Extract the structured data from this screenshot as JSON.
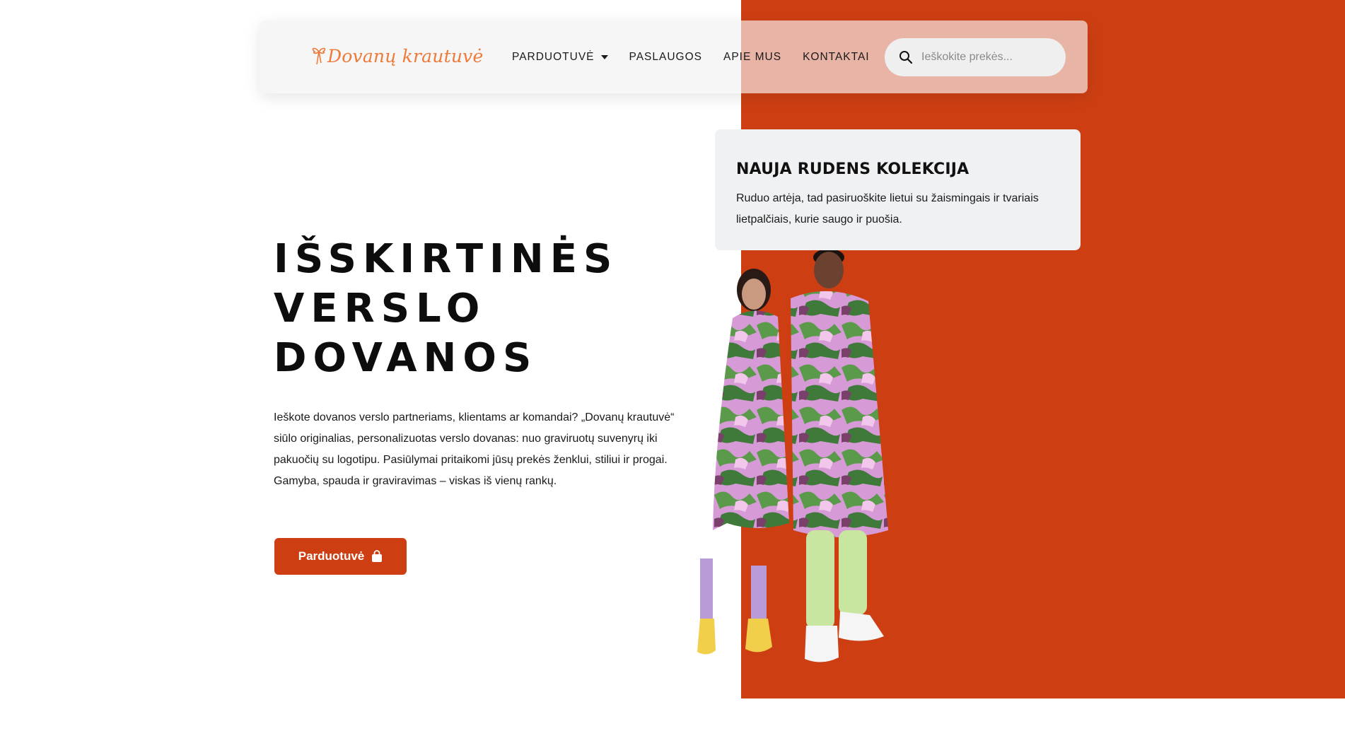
{
  "brand": {
    "logo_text": "Dovanų krautuvė",
    "color": "#ee7a3a"
  },
  "nav": {
    "items": [
      {
        "label": "PARDUOTUVĖ",
        "has_dropdown": true
      },
      {
        "label": "PASLAUGOS"
      },
      {
        "label": "APIE MUS"
      },
      {
        "label": "KONTAKTAI"
      }
    ]
  },
  "search": {
    "placeholder": "Ieškokite prekės...",
    "icon": "search-icon"
  },
  "hero": {
    "title_lines": [
      "IŠSKIRTINĖS",
      "VERSLO",
      "DOVANOS"
    ],
    "paragraph_lines": [
      "Ieškote dovanos verslo partneriams, klientams ar komandai? „Dovanų krautuvė“",
      "siūlo originalias, personalizuotas verslo dovanas: nuo graviruotų suvenyrų iki",
      "pakuočių su logotipu. Pasiūlymai pritaikomi jūsų prekės ženklui, stiliui ir progai.",
      "Gamyba, spauda ir graviravimas – viskas iš vienų rankų."
    ],
    "cta_label": "Parduotuvė",
    "cta_icon": "shopping-bag-icon"
  },
  "promo_card": {
    "title": "NAUJA RUDENS KOLEKCIJA",
    "text_lines": [
      "Ruduo artėja, tad pasiruoškite lietui su žaismingais ir tvariais",
      "lietpalčiais, kurie saugo ir puošia."
    ]
  },
  "colors": {
    "accent": "#cd3f13",
    "header_left": "#f6f6f7",
    "header_right": "#e8b4a6",
    "card_bg": "#f0f1f3"
  }
}
